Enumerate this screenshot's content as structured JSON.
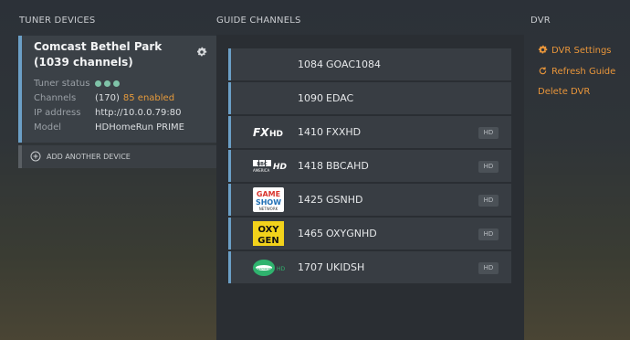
{
  "sections": {
    "tuner_devices": "TUNER DEVICES",
    "guide_channels": "GUIDE CHANNELS",
    "dvr": "DVR"
  },
  "device": {
    "title": "Comcast Bethel Park (1039 channels)",
    "tuner_status_label": "Tuner status",
    "tuner_status_color": "#7fc3a8",
    "channels_label": "Channels",
    "channels_count": "(170)",
    "channels_enabled": "85 enabled",
    "ip_label": "IP address",
    "ip_value": "http://10.0.0.79:80",
    "model_label": "Model",
    "model_value": "HDHomeRun PRIME"
  },
  "add_device_label": "ADD ANOTHER DEVICE",
  "channels": [
    {
      "number": "1084",
      "name": "GOAC1084",
      "logo": "",
      "hd": ""
    },
    {
      "number": "1090",
      "name": "EDAC",
      "logo": "",
      "hd": ""
    },
    {
      "number": "1410",
      "name": "FXXHD",
      "logo": "fxx-hd-logo",
      "hd": "HD"
    },
    {
      "number": "1418",
      "name": "BBCAHD",
      "logo": "bbc-america-hd-logo",
      "hd": "HD"
    },
    {
      "number": "1425",
      "name": "GSNHD",
      "logo": "game-show-network-logo",
      "hd": "HD"
    },
    {
      "number": "1465",
      "name": "OXYGNHD",
      "logo": "oxygen-logo",
      "hd": "HD"
    },
    {
      "number": "1707",
      "name": "UKIDSH",
      "logo": "universal-kids-hd-logo",
      "hd": "HD"
    }
  ],
  "logo_text": {
    "fxx": "FX",
    "fxx_hd": "HD",
    "bbc": "BBC",
    "bbc_sub": "AMERICA",
    "bbc_hd": "HD",
    "gsn_1": "GAME",
    "gsn_2": "SHOW",
    "gsn_3": "NETWORK",
    "oxy_1": "OXY",
    "oxy_2": "GEN",
    "ukids": "universal kids",
    "ukids_hd": "HD"
  },
  "dvr": {
    "settings_label": "DVR Settings",
    "refresh_label": "Refresh Guide",
    "delete_label": "Delete DVR"
  },
  "colors": {
    "accent_blue": "#6b9fc6",
    "accent_orange": "#e8953a",
    "status_green": "#7fc3a8"
  }
}
